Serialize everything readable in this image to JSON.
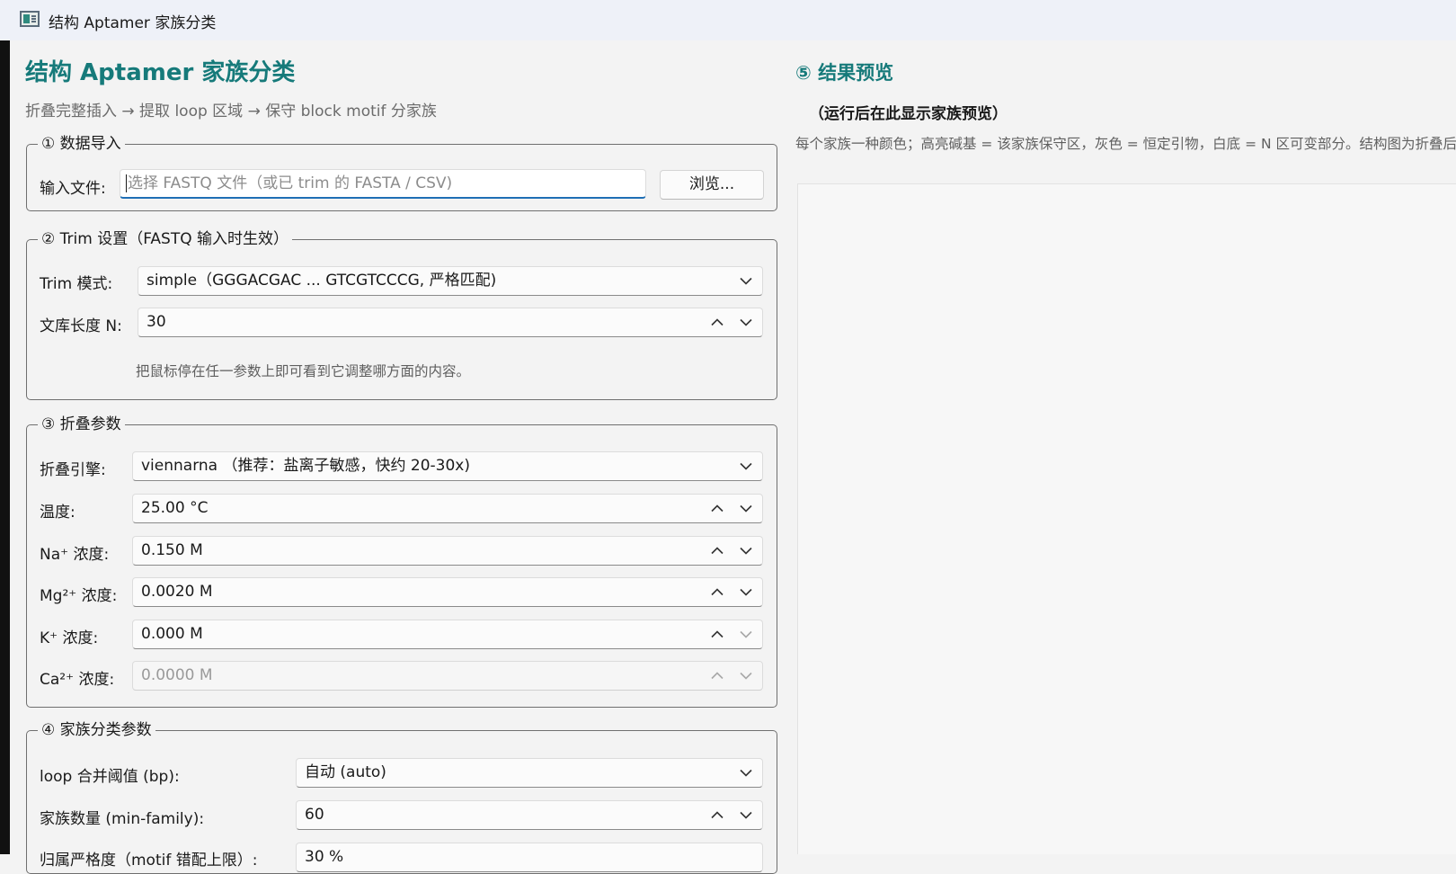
{
  "window": {
    "title": "结构 Aptamer 家族分类"
  },
  "header": {
    "title": "结构 Aptamer 家族分类",
    "pipeline": "折叠完整插入 → 提取 loop 区域 → 保守 block motif 分家族"
  },
  "data_import": {
    "legend": "① 数据导入",
    "input_label": "输入文件:",
    "input_placeholder": "选择 FASTQ 文件（或已 trim 的 FASTA / CSV)",
    "browse_label": "浏览..."
  },
  "trim": {
    "legend": "② Trim 设置（FASTQ 输入时生效）",
    "mode_label": "Trim 模式:",
    "mode_value": "simple（GGGACGAC ... GTCGTCCCG, 严格匹配)",
    "length_label": "文库长度 N:",
    "length_value": "30",
    "hint": "把鼠标停在任一参数上即可看到它调整哪方面的内容。"
  },
  "folding": {
    "legend": "③ 折叠参数",
    "engine_label": "折叠引擎:",
    "engine_value": "viennarna （推荐：盐离子敏感，快约 20-30x)",
    "temp_label": "温度:",
    "temp_value": "25.00 °C",
    "na_label": "Na⁺ 浓度:",
    "na_value": "0.150 M",
    "mg_label": "Mg²⁺ 浓度:",
    "mg_value": "0.0020 M",
    "k_label": "K⁺ 浓度:",
    "k_value": "0.000 M",
    "ca_label": "Ca²⁺ 浓度:",
    "ca_value": "0.0000 M"
  },
  "family": {
    "legend": "④ 家族分类参数",
    "loop_label": "loop 合并阈值 (bp):",
    "loop_value": "自动 (auto)",
    "count_label": "家族数量 (min-family):",
    "count_value": "60",
    "partial_label": "归属严格度（motif 错配上限）:",
    "partial_value": "30 %"
  },
  "preview": {
    "title": "⑤ 结果预览",
    "status": "（运行后在此显示家族预览）",
    "description": "每个家族一种颜色；高亮碱基 = 该家族保守区，灰色 = 恒定引物，白底 = N 区可变部分。结构图为折叠后的二级结构，用结构一致。"
  },
  "icons": [
    "app-icon",
    "chevron-down-icon",
    "chevron-up-icon"
  ],
  "colors": {
    "accent": "#167a7a",
    "focus": "#1f6fb5"
  }
}
